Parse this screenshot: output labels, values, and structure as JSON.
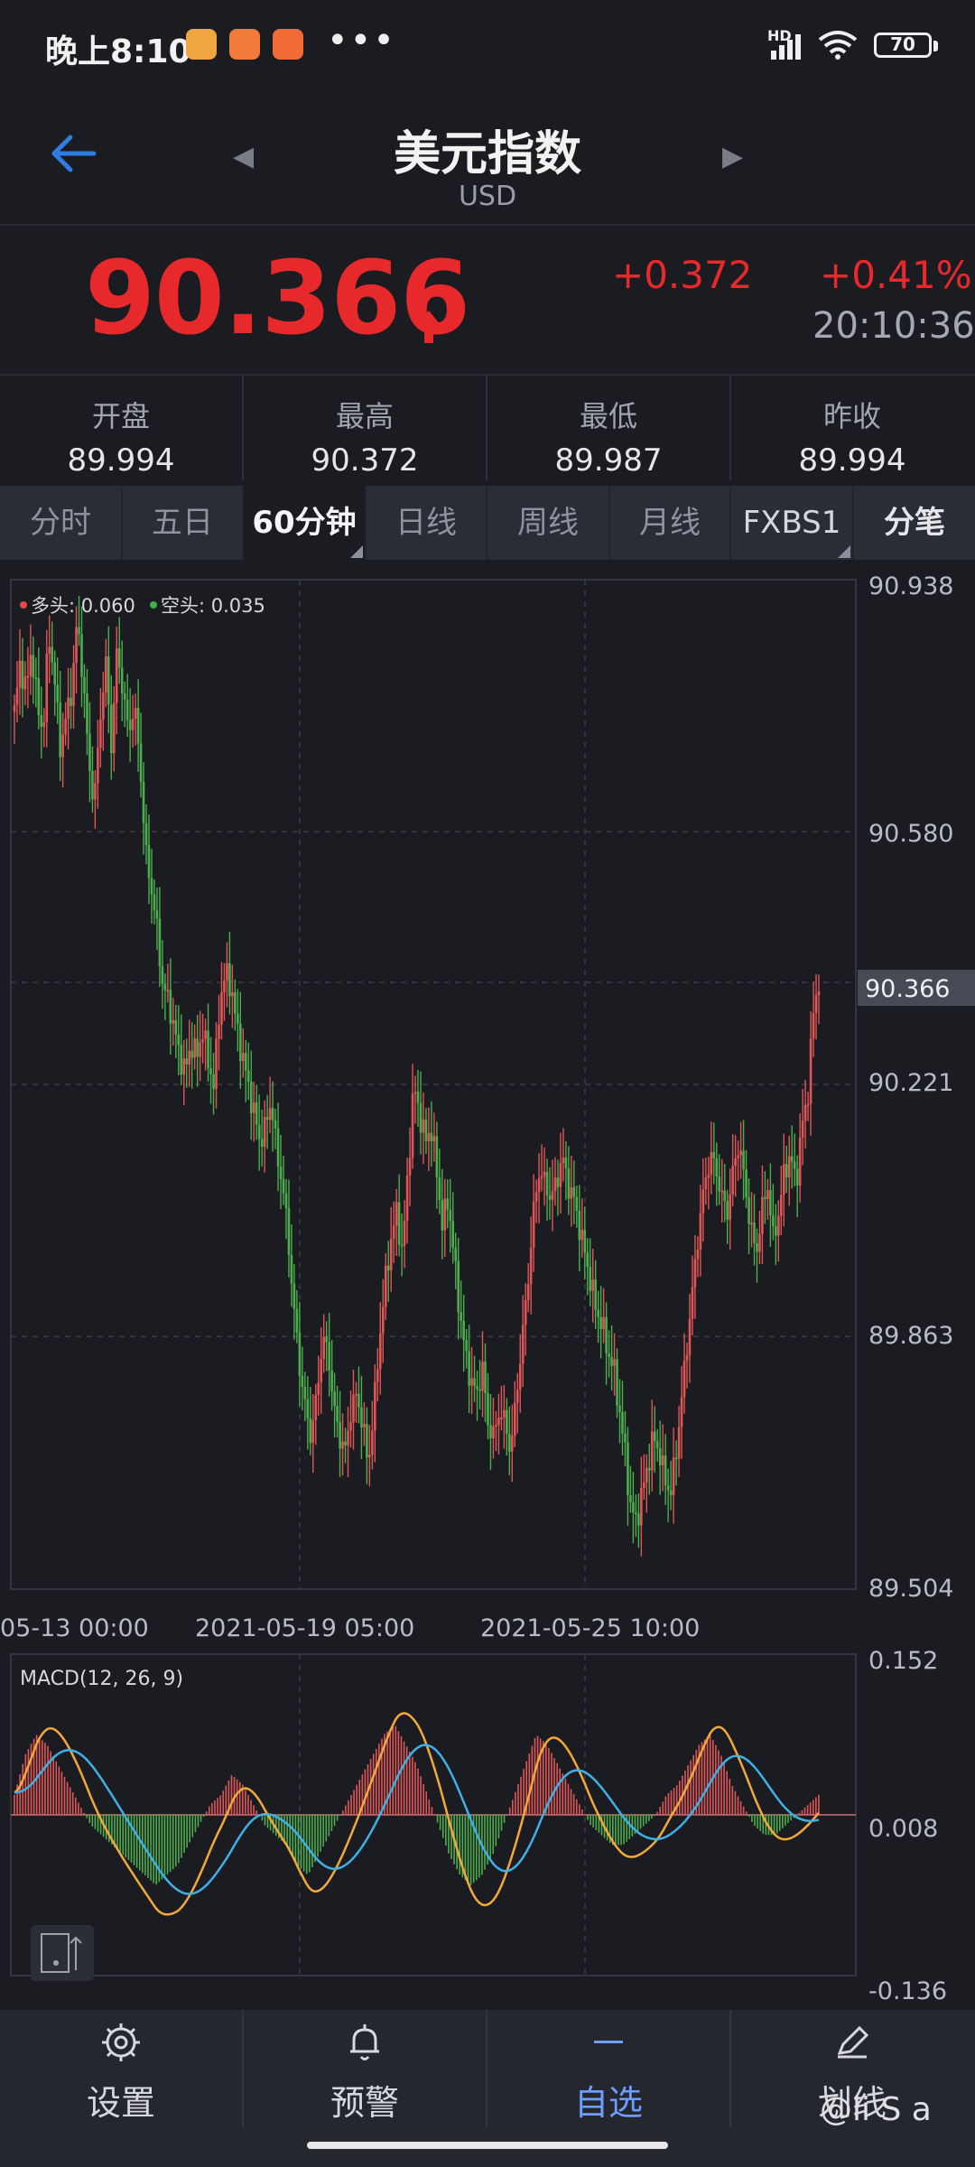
{
  "status_bar": {
    "time": "晚上8:10",
    "dots": "•••",
    "signal_label": "HD",
    "battery": "70",
    "app_icons": [
      "notes-app-icon",
      "mi-store-icon",
      "mi-icon"
    ]
  },
  "header": {
    "title": "美元指数",
    "subtitle": "USD"
  },
  "quote": {
    "price": "90.366",
    "change": "+0.372",
    "change_pct": "+0.41%",
    "time": "20:10:36",
    "direction": "up"
  },
  "stats": [
    {
      "label": "开盘",
      "value": "89.994"
    },
    {
      "label": "最高",
      "value": "90.372"
    },
    {
      "label": "最低",
      "value": "89.987"
    },
    {
      "label": "昨收",
      "value": "89.994"
    }
  ],
  "tabs": [
    {
      "label": "分时",
      "active": false,
      "has_dropdown": false
    },
    {
      "label": "五日",
      "active": false,
      "has_dropdown": false
    },
    {
      "label": "60分钟",
      "active": true,
      "has_dropdown": true
    },
    {
      "label": "日线",
      "active": false,
      "has_dropdown": false
    },
    {
      "label": "周线",
      "active": false,
      "has_dropdown": false
    },
    {
      "label": "月线",
      "active": false,
      "has_dropdown": false
    },
    {
      "label": "FXBS1",
      "active": false,
      "has_dropdown": true
    },
    {
      "label": "分笔",
      "active": false,
      "has_dropdown": false
    }
  ],
  "main_chart": {
    "legend": [
      {
        "label": "多头: 0.060",
        "color": "#e84a4a"
      },
      {
        "label": "空头: 0.035",
        "color": "#3fb24f"
      }
    ],
    "y_ticks": [
      "90.938",
      "90.580",
      "90.221",
      "89.863",
      "89.504"
    ],
    "current_price_tag": "90.366",
    "x_ticks": [
      "05-13 00:00",
      "2021-05-19 05:00",
      "2021-05-25 10:00"
    ]
  },
  "macd_panel": {
    "title": "MACD(12, 26, 9)",
    "y_ticks": [
      "0.152",
      "0.008",
      "-0.136"
    ]
  },
  "chart_data": [
    {
      "type": "candlestick",
      "title": "",
      "x_tick_labels": [
        "05-13 00:00",
        "2021-05-19 05:00",
        "2021-05-25 10:00"
      ],
      "ylim": [
        89.504,
        90.938
      ],
      "last_price": 90.366,
      "close_series": [
        90.75,
        90.82,
        90.78,
        90.84,
        90.76,
        90.72,
        90.86,
        90.8,
        90.7,
        90.74,
        90.78,
        90.88,
        90.8,
        90.68,
        90.62,
        90.74,
        90.82,
        90.7,
        90.84,
        90.78,
        90.72,
        90.76,
        90.68,
        90.55,
        90.5,
        90.44,
        90.36,
        90.34,
        90.3,
        90.26,
        90.24,
        90.28,
        90.26,
        90.3,
        90.25,
        90.22,
        90.34,
        90.38,
        90.36,
        90.3,
        90.26,
        90.22,
        90.18,
        90.14,
        90.16,
        90.2,
        90.12,
        90.08,
        90.0,
        89.9,
        89.82,
        89.76,
        89.72,
        89.78,
        89.86,
        89.84,
        89.76,
        89.72,
        89.7,
        89.76,
        89.78,
        89.74,
        89.68,
        89.76,
        89.86,
        89.94,
        90.0,
        90.04,
        89.98,
        90.1,
        90.22,
        90.18,
        90.14,
        90.16,
        90.1,
        90.02,
        90.06,
        89.98,
        89.9,
        89.84,
        89.8,
        89.78,
        89.82,
        89.74,
        89.72,
        89.76,
        89.74,
        89.7,
        89.78,
        89.86,
        89.94,
        90.04,
        90.1,
        90.08,
        90.06,
        90.08,
        90.12,
        90.08,
        90.06,
        90.02,
        89.98,
        89.94,
        89.9,
        89.88,
        89.84,
        89.82,
        89.76,
        89.7,
        89.62,
        89.6,
        89.64,
        89.68,
        89.72,
        89.7,
        89.66,
        89.64,
        89.7,
        89.78,
        89.86,
        89.94,
        90.02,
        90.08,
        90.12,
        90.1,
        90.06,
        90.04,
        90.1,
        90.14,
        90.08,
        90.02,
        89.98,
        90.04,
        90.08,
        90.0,
        90.04,
        90.1,
        90.12,
        90.08,
        90.16,
        90.2,
        90.32,
        90.37
      ]
    },
    {
      "type": "line",
      "title": "MACD(12, 26, 9)",
      "ylim": [
        -0.136,
        0.152
      ],
      "series": [
        {
          "name": "MACD",
          "color": "#e84a4a",
          "values": [
            0.02,
            0.06,
            0.08,
            0.07,
            0.05,
            0.03,
            0.01,
            -0.01,
            -0.02,
            -0.03,
            -0.04,
            -0.05,
            -0.06,
            -0.07,
            -0.06,
            -0.05,
            -0.03,
            -0.01,
            0.01,
            0.02,
            0.04,
            0.03,
            0.01,
            -0.01,
            -0.02,
            -0.03,
            -0.05,
            -0.06,
            -0.04,
            -0.02,
            0.0,
            0.02,
            0.04,
            0.06,
            0.08,
            0.09,
            0.07,
            0.05,
            0.02,
            -0.01,
            -0.04,
            -0.06,
            -0.07,
            -0.06,
            -0.04,
            -0.01,
            0.02,
            0.05,
            0.08,
            0.07,
            0.05,
            0.03,
            0.01,
            -0.01,
            -0.02,
            -0.03,
            -0.03,
            -0.02,
            -0.01,
            0.0,
            0.02,
            0.03,
            0.05,
            0.07,
            0.08,
            0.06,
            0.03,
            0.01,
            -0.01,
            -0.02,
            -0.02,
            -0.01,
            0.0,
            0.01,
            0.02
          ]
        }
      ]
    }
  ],
  "bottom_nav": [
    {
      "label": "设置",
      "icon": "gear-icon",
      "active": false
    },
    {
      "label": "预警",
      "icon": "bell-icon",
      "active": false
    },
    {
      "label": "自选",
      "icon": "dash-icon",
      "active": true
    },
    {
      "label": "划线",
      "icon": "pen-icon",
      "active": false
    }
  ],
  "watermark": "@li S a"
}
